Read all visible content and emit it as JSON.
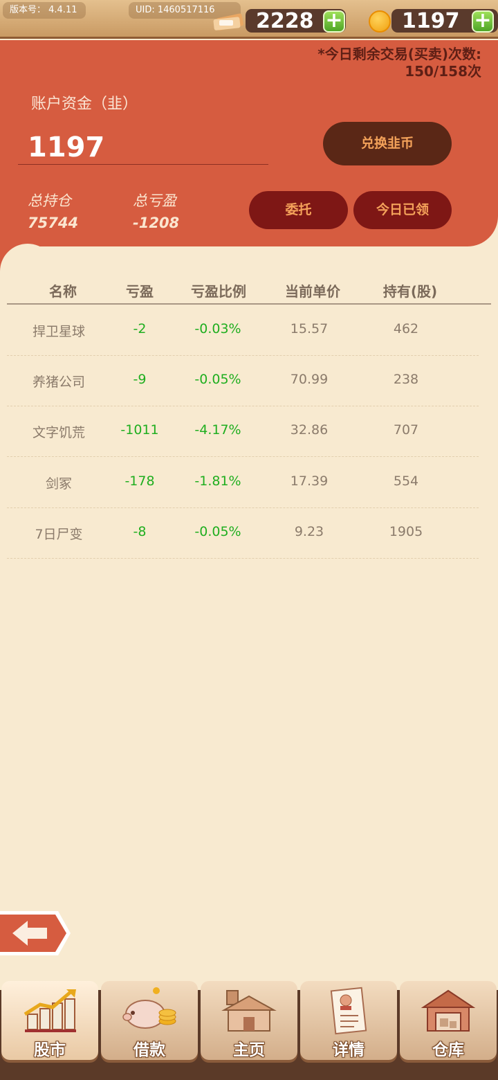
{
  "topbar": {
    "version": "版本号： 4.4.11",
    "uid": "UID: 1460517116",
    "tickets": "2228",
    "coins": "1197",
    "plus": "+"
  },
  "account": {
    "trade_remaining_line1": "*今日剩余交易(买卖)次数:",
    "trade_remaining_line2": "150/158次",
    "balance_label": "账户资金（韭）",
    "balance_value": "1197",
    "exchange_label": "兑换韭币",
    "total_position_label": "总持仓",
    "total_position_value": "75744",
    "total_pl_label": "总亏盈",
    "total_pl_value": "-1208",
    "entrust_label": "委托",
    "claimed_label": "今日已领"
  },
  "table": {
    "headers": [
      "名称",
      "亏盈",
      "亏盈比例",
      "当前单价",
      "持有(股)"
    ],
    "rows": [
      {
        "name": "捍卫星球",
        "pl": "-2",
        "ratio": "-0.03%",
        "price": "15.57",
        "held": "462"
      },
      {
        "name": "养猪公司",
        "pl": "-9",
        "ratio": "-0.05%",
        "price": "70.99",
        "held": "238"
      },
      {
        "name": "文字饥荒",
        "pl": "-1011",
        "ratio": "-4.17%",
        "price": "32.86",
        "held": "707"
      },
      {
        "name": "剑冢",
        "pl": "-178",
        "ratio": "-1.81%",
        "price": "17.39",
        "held": "554"
      },
      {
        "name": "7日尸变",
        "pl": "-8",
        "ratio": "-0.05%",
        "price": "9.23",
        "held": "1905"
      }
    ]
  },
  "nav": [
    {
      "label": "股市",
      "icon": "stock-chart-icon"
    },
    {
      "label": "借款",
      "icon": "piggy-bank-icon"
    },
    {
      "label": "主页",
      "icon": "home-icon"
    },
    {
      "label": "详情",
      "icon": "profile-document-icon"
    },
    {
      "label": "仓库",
      "icon": "warehouse-icon"
    }
  ],
  "colors": {
    "panel": "#d65c40",
    "background": "#f8ead0",
    "loss_green": "#1fae1f"
  }
}
